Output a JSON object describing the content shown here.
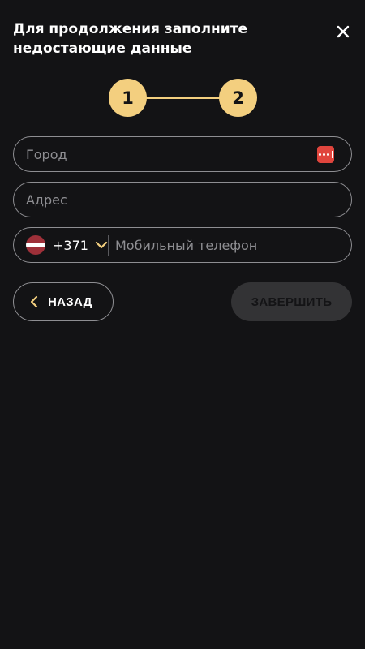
{
  "header": {
    "title": "Для продолжения заполните недостающие данные"
  },
  "stepper": {
    "steps": [
      "1",
      "2"
    ],
    "current": 2,
    "accent_color": "#f3cf7f"
  },
  "form": {
    "city": {
      "placeholder": "Город",
      "value": "",
      "autofill_icon": "password-manager-icon"
    },
    "address": {
      "placeholder": "Адрес",
      "value": ""
    },
    "phone": {
      "country_flag": "latvia-flag",
      "country_code": "+371",
      "placeholder": "Мобильный телефон",
      "value": ""
    }
  },
  "actions": {
    "back_label": "НАЗАД",
    "finish_label": "ЗАВЕРШИТЬ",
    "finish_disabled": true
  },
  "colors": {
    "background": "#131315",
    "accent": "#f3cf7f",
    "border": "#8e8e92",
    "disabled_button": "#333335",
    "autofill_icon": "#e0453d"
  }
}
